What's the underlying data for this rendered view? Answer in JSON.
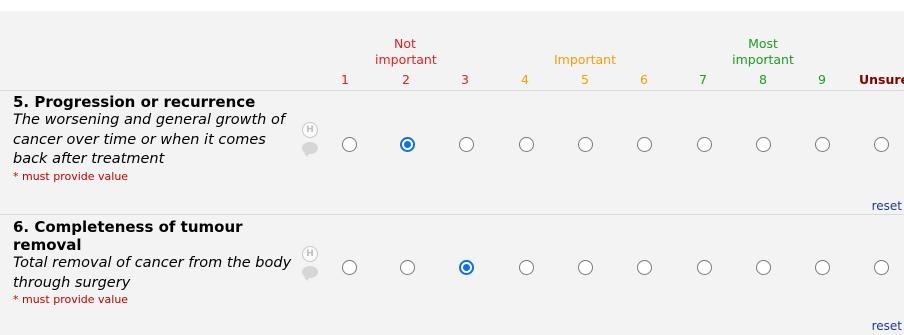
{
  "scale": {
    "groups": [
      {
        "lines": [
          "Not",
          "important"
        ],
        "color": "#e02020"
      },
      {
        "lines": [
          "Important"
        ],
        "color": "#f0a000"
      },
      {
        "lines": [
          "Most",
          "important"
        ],
        "color": "#209a20"
      }
    ],
    "numbers": [
      {
        "label": "1",
        "color": "#e02020"
      },
      {
        "label": "2",
        "color": "#e02020"
      },
      {
        "label": "3",
        "color": "#e02020"
      },
      {
        "label": "4",
        "color": "#f0a000"
      },
      {
        "label": "5",
        "color": "#f0a000"
      },
      {
        "label": "6",
        "color": "#f0a000"
      },
      {
        "label": "7",
        "color": "#209a20"
      },
      {
        "label": "8",
        "color": "#209a20"
      },
      {
        "label": "9",
        "color": "#209a20"
      }
    ],
    "unsure_label": "Unsure"
  },
  "questions": [
    {
      "title": "5. Progression or recurrence",
      "description": "The worsening and general growth of cancer over time or when it comes back after treatment",
      "required_note": "* must provide value",
      "history_icon_letter": "H",
      "selected": "2",
      "reset_label": "reset"
    },
    {
      "title": "6. Completeness of tumour removal",
      "description": "Total removal of cancer from the body through surgery",
      "required_note": "* must provide value",
      "history_icon_letter": "H",
      "selected": "3",
      "reset_label": "reset"
    }
  ],
  "accent_color": "#0a6ef0"
}
